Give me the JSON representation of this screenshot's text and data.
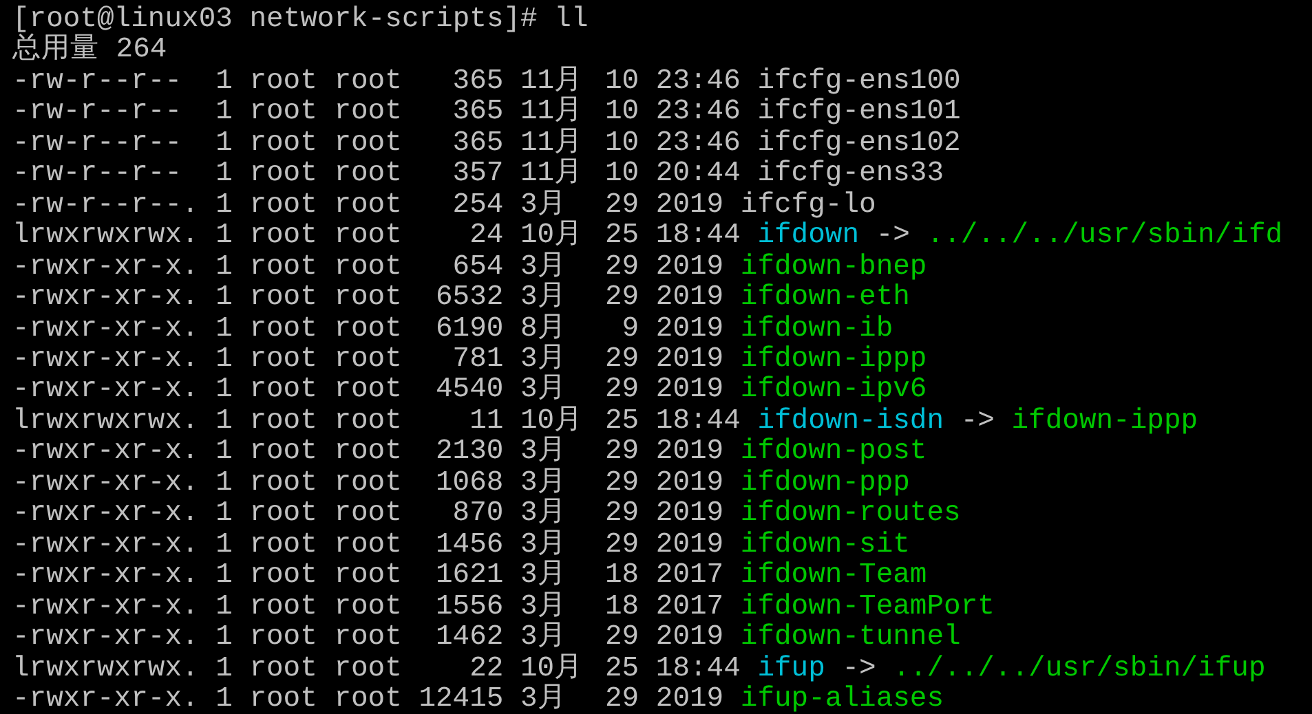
{
  "terminal": {
    "prompt": "[root@linux03 network-scripts]#",
    "command": "ll",
    "total": "总用量 264",
    "entries": [
      {
        "kind": "file",
        "permissions": "-rw-r--r--",
        "links": "1",
        "owner": "root",
        "group": "root",
        "size": "365",
        "month": "11月",
        "day": "10",
        "time": "23:46",
        "name": "ifcfg-ens100"
      },
      {
        "kind": "file",
        "permissions": "-rw-r--r--",
        "links": "1",
        "owner": "root",
        "group": "root",
        "size": "365",
        "month": "11月",
        "day": "10",
        "time": "23:46",
        "name": "ifcfg-ens101"
      },
      {
        "kind": "file",
        "permissions": "-rw-r--r--",
        "links": "1",
        "owner": "root",
        "group": "root",
        "size": "365",
        "month": "11月",
        "day": "10",
        "time": "23:46",
        "name": "ifcfg-ens102"
      },
      {
        "kind": "file",
        "permissions": "-rw-r--r--",
        "links": "1",
        "owner": "root",
        "group": "root",
        "size": "357",
        "month": "11月",
        "day": "10",
        "time": "20:44",
        "name": "ifcfg-ens33"
      },
      {
        "kind": "file",
        "permissions": "-rw-r--r--.",
        "links": "1",
        "owner": "root",
        "group": "root",
        "size": "254",
        "month": "3月",
        "day": "29",
        "time": "2019",
        "name": "ifcfg-lo"
      },
      {
        "kind": "link",
        "permissions": "lrwxrwxrwx.",
        "links": "1",
        "owner": "root",
        "group": "root",
        "size": "24",
        "month": "10月",
        "day": "25",
        "time": "18:44",
        "name": "ifdown",
        "arrow": "->",
        "target": "../../../usr/sbin/ifd"
      },
      {
        "kind": "exec",
        "permissions": "-rwxr-xr-x.",
        "links": "1",
        "owner": "root",
        "group": "root",
        "size": "654",
        "month": "3月",
        "day": "29",
        "time": "2019",
        "name": "ifdown-bnep"
      },
      {
        "kind": "exec",
        "permissions": "-rwxr-xr-x.",
        "links": "1",
        "owner": "root",
        "group": "root",
        "size": "6532",
        "month": "3月",
        "day": "29",
        "time": "2019",
        "name": "ifdown-eth"
      },
      {
        "kind": "exec",
        "permissions": "-rwxr-xr-x.",
        "links": "1",
        "owner": "root",
        "group": "root",
        "size": "6190",
        "month": "8月",
        "day": "9",
        "time": "2019",
        "name": "ifdown-ib"
      },
      {
        "kind": "exec",
        "permissions": "-rwxr-xr-x.",
        "links": "1",
        "owner": "root",
        "group": "root",
        "size": "781",
        "month": "3月",
        "day": "29",
        "time": "2019",
        "name": "ifdown-ippp"
      },
      {
        "kind": "exec",
        "permissions": "-rwxr-xr-x.",
        "links": "1",
        "owner": "root",
        "group": "root",
        "size": "4540",
        "month": "3月",
        "day": "29",
        "time": "2019",
        "name": "ifdown-ipv6"
      },
      {
        "kind": "link",
        "permissions": "lrwxrwxrwx.",
        "links": "1",
        "owner": "root",
        "group": "root",
        "size": "11",
        "month": "10月",
        "day": "25",
        "time": "18:44",
        "name": "ifdown-isdn",
        "arrow": "->",
        "target": "ifdown-ippp"
      },
      {
        "kind": "exec",
        "permissions": "-rwxr-xr-x.",
        "links": "1",
        "owner": "root",
        "group": "root",
        "size": "2130",
        "month": "3月",
        "day": "29",
        "time": "2019",
        "name": "ifdown-post"
      },
      {
        "kind": "exec",
        "permissions": "-rwxr-xr-x.",
        "links": "1",
        "owner": "root",
        "group": "root",
        "size": "1068",
        "month": "3月",
        "day": "29",
        "time": "2019",
        "name": "ifdown-ppp"
      },
      {
        "kind": "exec",
        "permissions": "-rwxr-xr-x.",
        "links": "1",
        "owner": "root",
        "group": "root",
        "size": "870",
        "month": "3月",
        "day": "29",
        "time": "2019",
        "name": "ifdown-routes"
      },
      {
        "kind": "exec",
        "permissions": "-rwxr-xr-x.",
        "links": "1",
        "owner": "root",
        "group": "root",
        "size": "1456",
        "month": "3月",
        "day": "29",
        "time": "2019",
        "name": "ifdown-sit"
      },
      {
        "kind": "exec",
        "permissions": "-rwxr-xr-x.",
        "links": "1",
        "owner": "root",
        "group": "root",
        "size": "1621",
        "month": "3月",
        "day": "18",
        "time": "2017",
        "name": "ifdown-Team"
      },
      {
        "kind": "exec",
        "permissions": "-rwxr-xr-x.",
        "links": "1",
        "owner": "root",
        "group": "root",
        "size": "1556",
        "month": "3月",
        "day": "18",
        "time": "2017",
        "name": "ifdown-TeamPort"
      },
      {
        "kind": "exec",
        "permissions": "-rwxr-xr-x.",
        "links": "1",
        "owner": "root",
        "group": "root",
        "size": "1462",
        "month": "3月",
        "day": "29",
        "time": "2019",
        "name": "ifdown-tunnel"
      },
      {
        "kind": "link",
        "permissions": "lrwxrwxrwx.",
        "links": "1",
        "owner": "root",
        "group": "root",
        "size": "22",
        "month": "10月",
        "day": "25",
        "time": "18:44",
        "name": "ifup",
        "arrow": "->",
        "target": "../../../usr/sbin/ifup"
      },
      {
        "kind": "exec",
        "permissions": "-rwxr-xr-x.",
        "links": "1",
        "owner": "root",
        "group": "root",
        "size": "12415",
        "month": "3月",
        "day": "29",
        "time": "2019",
        "name": "ifup-aliases"
      }
    ]
  }
}
